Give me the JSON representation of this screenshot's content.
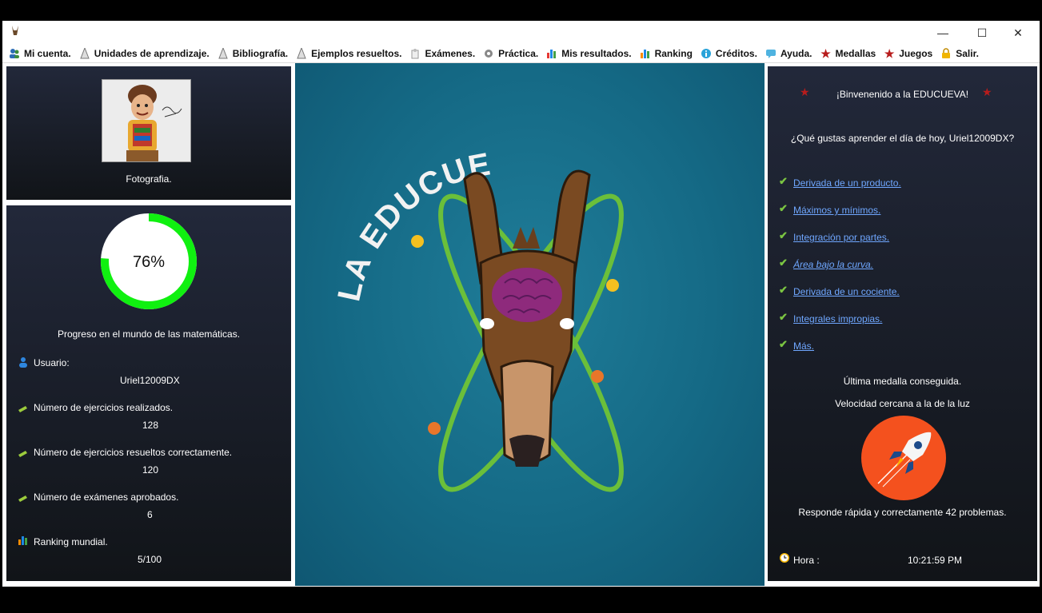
{
  "window": {
    "controls": {
      "minimize": "—",
      "maximize": "☐",
      "close": "✕"
    }
  },
  "menu": [
    {
      "label": "Mi cuenta.",
      "icon": "users-icon"
    },
    {
      "label": "Unidades de aprendizaje.",
      "icon": "book-icon"
    },
    {
      "label": "Bibliografía.",
      "icon": "book-icon"
    },
    {
      "label": "Ejemplos resueltos.",
      "icon": "book-icon"
    },
    {
      "label": "Exámenes.",
      "icon": "exam-icon"
    },
    {
      "label": "Práctica.",
      "icon": "gear-icon"
    },
    {
      "label": "Mis resultados.",
      "icon": "bar-chart-icon"
    },
    {
      "label": "Ranking",
      "icon": "bar-chart-icon"
    },
    {
      "label": "Créditos.",
      "icon": "info-icon"
    },
    {
      "label": "Ayuda.",
      "icon": "chat-icon"
    },
    {
      "label": "Medallas",
      "icon": "star-icon"
    },
    {
      "label": "Juegos",
      "icon": "star-icon"
    },
    {
      "label": "Salir.",
      "icon": "lock-icon"
    }
  ],
  "profile": {
    "photo_caption": "Fotografia."
  },
  "progress": {
    "percent": 76,
    "percent_label": "76%",
    "caption": "Progreso en el mundo de las matemáticas."
  },
  "stats": {
    "user_label": "Usuario:",
    "user_value": "Uriel12009DX",
    "exercises_label": "Número de ejercicios realizados.",
    "exercises_value": "128",
    "correct_label": "Número de ejercicios resueltos correctamente.",
    "correct_value": "120",
    "exams_label": "Número de exámenes aprobados.",
    "exams_value": "6",
    "ranking_label": "Ranking mundial.",
    "ranking_value": "5/100"
  },
  "logo": {
    "text": "LA EDUCUEVA"
  },
  "right": {
    "welcome": "¡Binvenenido a la EDUCUEVA!",
    "question": "¿Qué gustas aprender el día de hoy, Uriel12009DX?",
    "topics": [
      "Derivada de un producto.",
      "Máximos y mínimos.",
      "Integración por partes.",
      "Área bajo la curva.",
      "Derivada de un cociente.",
      "Integrales impropias.",
      "Más."
    ],
    "last_medal_label": "Última medalla conseguida.",
    "medal_name": "Velocidad cercana a la de la luz",
    "medal_desc": "Responde rápida y correctamente 42 problemas.",
    "time_label": "Hora :",
    "time_value": "10:21:59 PM"
  },
  "colors": {
    "progress_ring": "#10f010",
    "medal_bg": "#f4511e",
    "link": "#6fa7ff",
    "check": "#7bc542"
  }
}
